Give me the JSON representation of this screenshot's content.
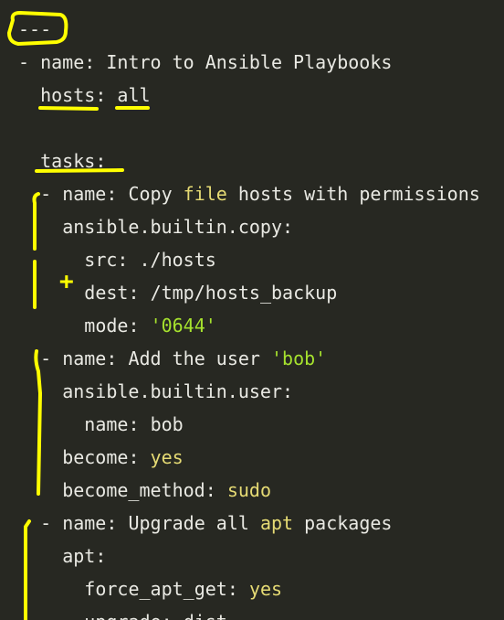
{
  "editor": {
    "lines": [
      {
        "indent": 0,
        "dash": false,
        "key": "",
        "sep": "",
        "value": "---",
        "value_style": "plain"
      },
      {
        "indent": 0,
        "dash": true,
        "key": "name",
        "sep": ": ",
        "value": "Intro to Ansible Playbooks",
        "value_style": "plain"
      },
      {
        "indent": 2,
        "dash": false,
        "key": "hosts",
        "sep": ": ",
        "value": "all",
        "value_style": "plain"
      },
      {
        "indent": 0,
        "dash": false,
        "key": "",
        "sep": "",
        "value": "",
        "value_style": "plain"
      },
      {
        "indent": 2,
        "dash": false,
        "key": "tasks",
        "sep": ":",
        "value": "",
        "value_style": "plain"
      },
      {
        "indent": 2,
        "dash": true,
        "key": "name",
        "sep": ": ",
        "value_parts": [
          {
            "t": "Copy ",
            "s": "plain"
          },
          {
            "t": "file",
            "s": "hl"
          },
          {
            "t": " hosts with permissions",
            "s": "plain"
          }
        ]
      },
      {
        "indent": 4,
        "dash": false,
        "key": "ansible.builtin.copy",
        "sep": ":",
        "value": "",
        "value_style": "plain"
      },
      {
        "indent": 6,
        "dash": false,
        "key": "src",
        "sep": ": ",
        "value": "./hosts",
        "value_style": "plain"
      },
      {
        "indent": 6,
        "dash": false,
        "key": "dest",
        "sep": ": ",
        "value": "/tmp/hosts_backup",
        "value_style": "plain"
      },
      {
        "indent": 6,
        "dash": false,
        "key": "mode",
        "sep": ": ",
        "value": "'0644'",
        "value_style": "str"
      },
      {
        "indent": 2,
        "dash": true,
        "key": "name",
        "sep": ": ",
        "value_parts": [
          {
            "t": "Add the user ",
            "s": "plain"
          },
          {
            "t": "'bob'",
            "s": "str"
          }
        ]
      },
      {
        "indent": 4,
        "dash": false,
        "key": "ansible.builtin.user",
        "sep": ":",
        "value": "",
        "value_style": "plain"
      },
      {
        "indent": 6,
        "dash": false,
        "key": "name",
        "sep": ": ",
        "value": "bob",
        "value_style": "plain"
      },
      {
        "indent": 4,
        "dash": false,
        "key": "become",
        "sep": ": ",
        "value": "yes",
        "value_style": "hl"
      },
      {
        "indent": 4,
        "dash": false,
        "key": "become_method",
        "sep": ": ",
        "value": "sudo",
        "value_style": "hl"
      },
      {
        "indent": 2,
        "dash": true,
        "key": "name",
        "sep": ": ",
        "value_parts": [
          {
            "t": "Upgrade all ",
            "s": "plain"
          },
          {
            "t": "apt",
            "s": "hl"
          },
          {
            "t": " packages",
            "s": "plain"
          }
        ]
      },
      {
        "indent": 4,
        "dash": false,
        "key": "apt",
        "sep": ":",
        "value": "",
        "value_style": "plain"
      },
      {
        "indent": 6,
        "dash": false,
        "key": "force_apt_get",
        "sep": ": ",
        "value": "yes",
        "value_style": "hl"
      },
      {
        "indent": 6,
        "dash": false,
        "key": "upgrade",
        "sep": ": ",
        "value": "dist",
        "value_style": "plain"
      }
    ]
  },
  "annotations": {
    "color": "#ffff00",
    "plus_symbol": "+"
  },
  "colors": {
    "background": "#272822",
    "text": "#e9e9e3",
    "keyword_yellow": "#e6db74",
    "string_green": "#a6e22e"
  }
}
